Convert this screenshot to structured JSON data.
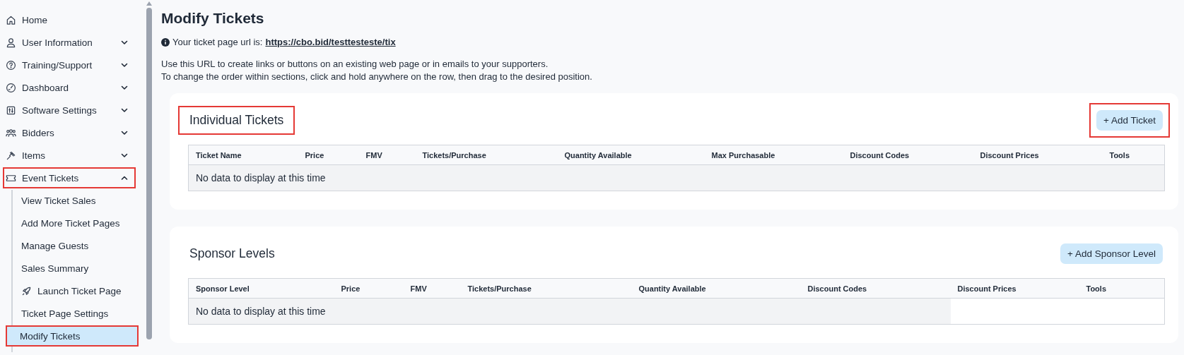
{
  "sidebar": {
    "items": [
      {
        "label": "Home",
        "highlighted": false
      },
      {
        "label": "User Information",
        "expanded": false,
        "highlighted": false
      },
      {
        "label": "Training/Support",
        "expanded": false,
        "highlighted": false
      },
      {
        "label": "Dashboard",
        "expanded": false,
        "highlighted": false
      },
      {
        "label": "Software Settings",
        "expanded": false,
        "highlighted": false
      },
      {
        "label": "Bidders",
        "expanded": false,
        "highlighted": false
      },
      {
        "label": "Items",
        "expanded": false,
        "highlighted": false
      },
      {
        "label": "Event Tickets",
        "expanded": true,
        "highlighted": true,
        "children": [
          {
            "label": "View Ticket Sales",
            "selected": false,
            "highlighted": false
          },
          {
            "label": "Add More Ticket Pages",
            "selected": false,
            "highlighted": false
          },
          {
            "label": "Manage Guests",
            "selected": false,
            "highlighted": false
          },
          {
            "label": "Sales Summary",
            "selected": false,
            "highlighted": false
          },
          {
            "label": "Launch Ticket Page",
            "has_icon": true,
            "selected": false,
            "highlighted": false
          },
          {
            "label": "Ticket Page Settings",
            "selected": false,
            "highlighted": false
          },
          {
            "label": "Modify Tickets",
            "selected": true,
            "highlighted": true
          }
        ]
      }
    ]
  },
  "page": {
    "title": "Modify Tickets",
    "url_label": "Your ticket page url is:",
    "url": "https://cbo.bid/testtesteste/tix",
    "notes": [
      "Use this URL to create links or buttons on an existing web page or in emails to your supporters.",
      "To change the order within sections, click and hold anywhere on the row, then drag to the desired position."
    ]
  },
  "sections": [
    {
      "title": "Individual Tickets",
      "title_highlighted": true,
      "button": "+ Add Ticket",
      "button_highlighted": true,
      "columns": [
        "Ticket Name",
        "Price",
        "FMV",
        "Tickets/Purchase",
        "Quantity Available",
        "Max Purchasable",
        "Discount Codes",
        "Discount Prices",
        "Tools"
      ],
      "empty_message": "No data to display at this time"
    },
    {
      "title": "Sponsor Levels",
      "title_highlighted": false,
      "button": "+ Add Sponsor Level",
      "button_highlighted": false,
      "columns": [
        "Sponsor Level",
        "Price",
        "FMV",
        "Tickets/Purchase",
        "Quantity Available",
        "Discount Codes",
        "Discount Prices",
        "Tools"
      ],
      "empty_message": "No data to display at this time"
    }
  ]
}
